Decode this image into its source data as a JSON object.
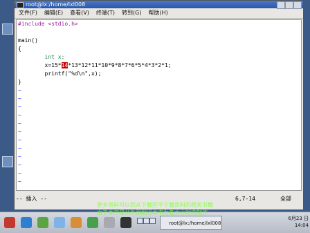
{
  "window": {
    "title": "root@lx:/home/lxl008",
    "menu": [
      "文件(F)",
      "编辑(E)",
      "查看(V)",
      "终端(T)",
      "转到(G)",
      "帮助(H)"
    ]
  },
  "editor": {
    "lines": [
      "#include <stdio.h>",
      "",
      "main()",
      "{",
      "        int x;",
      "        x=15*",
      "        printf(\"%d\\n\",x);",
      "}"
    ],
    "cursor_char": "14",
    "after_cursor": "*13*12*11*10*9*8*7*6*5*4*3*2*1;",
    "tilde_rows": "~"
  },
  "status": {
    "mode": "-- 插入 --",
    "position": "6,7-14",
    "scroll": "全部"
  },
  "taskbar": {
    "task_label": "root@lx:/home/lxl008",
    "clock_date": "6月23 日",
    "clock_time": "14:04"
  },
  "overlay": {
    "text1": "更多资料可以到从下载区中下载资料的相关书籍",
    "text2": "由于本书是从外国翻译本书为各大小时内制作"
  },
  "colors": {
    "desktop": "#3b5a88",
    "title": "#2a56a8",
    "preproc": "#a020a0",
    "type": "#2e8b57",
    "tilde": "#2020ff",
    "cursor": "#cc0000"
  }
}
